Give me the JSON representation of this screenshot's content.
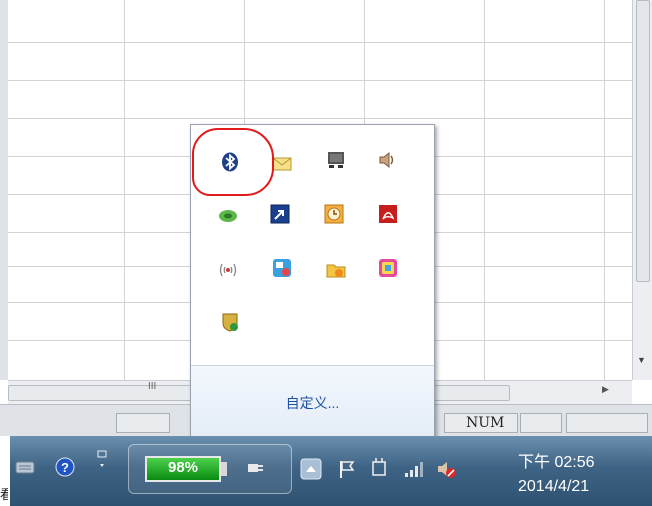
{
  "spreadsheet": {
    "hscroll_grip": "III",
    "status_num": "NUM"
  },
  "tray_popup": {
    "customize_label": "自定义...",
    "icons": [
      "bluetooth-icon",
      "mail-icon",
      "monitor-icon",
      "speaker-icon",
      "nvidia-icon",
      "shortcut-icon",
      "clock-icon",
      "pdf-icon",
      "wireless-icon",
      "remote-icon",
      "folder-badge-icon",
      "colorful-app-icon",
      "shield-icon"
    ]
  },
  "taskbar": {
    "battery_percent": "98%",
    "time": "下午 02:56",
    "date": "2014/4/21",
    "left_fragment": "看"
  },
  "colors": {
    "taskbar": "#3f6384",
    "battery_fill": "#2eb82e",
    "link": "#1e4fa0",
    "annotation": "#e21a1a"
  }
}
